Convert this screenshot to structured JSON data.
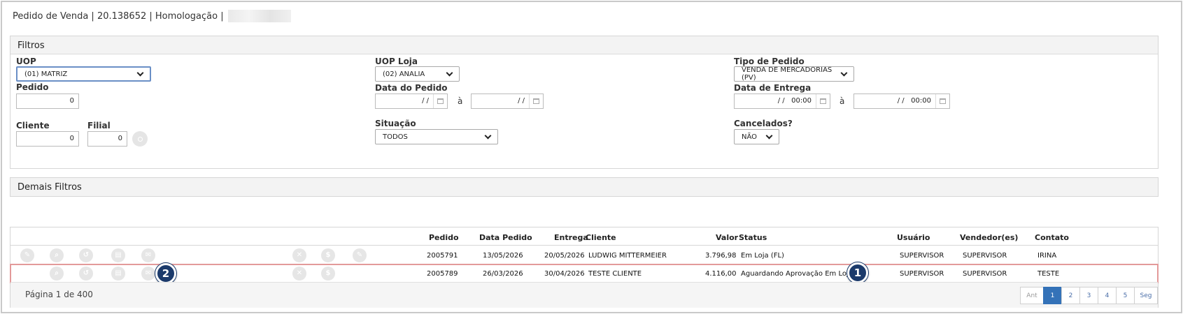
{
  "header": {
    "title": "Pedido de Venda | 20.138652 | Homologação |"
  },
  "filters": {
    "title": "Filtros",
    "uop": {
      "label": "UOP",
      "value": "(01) MATRIZ"
    },
    "uop_loja": {
      "label": "UOP Loja",
      "value": "(02) ANALIA"
    },
    "tipo_pedido": {
      "label": "Tipo de Pedido",
      "value": "VENDA DE MERCADORIAS (PV)"
    },
    "pedido": {
      "label": "Pedido",
      "value": "0"
    },
    "data_pedido": {
      "label": "Data do Pedido",
      "from": "/ /",
      "to": "/ /",
      "sep": "à"
    },
    "data_entrega": {
      "label": "Data de Entrega",
      "from": "/ /   00:00",
      "to": "/ /   00:00",
      "sep": "à"
    },
    "cliente": {
      "label": "Cliente",
      "value": "0"
    },
    "filial": {
      "label": "Filial",
      "value": "0"
    },
    "situacao": {
      "label": "Situação",
      "value": "TODOS"
    },
    "cancelados": {
      "label": "Cancelados?",
      "value": "NÃO"
    }
  },
  "more_filters": {
    "title": "Demais Filtros"
  },
  "grid": {
    "columns": {
      "pedido": "Pedido",
      "data_pedido": "Data Pedido",
      "entrega": "Entrega",
      "cliente": "Cliente",
      "valor": "Valor",
      "status": "Status",
      "usuario": "Usuário",
      "vendedor": "Vendedor(es)",
      "contato": "Contato"
    },
    "rows": [
      {
        "pedido": "2005791",
        "data_pedido": "13/05/2026",
        "entrega": "20/05/2026",
        "cliente": "LUDWIG MITTERMEIER",
        "valor": "3.796,98",
        "status": "Em Loja (FL)",
        "usuario": "SUPERVISOR",
        "vendedor": "SUPERVISOR",
        "contato": "IRINA"
      },
      {
        "pedido": "2005789",
        "data_pedido": "26/03/2026",
        "entrega": "30/04/2026",
        "cliente": "TESTE CLIENTE",
        "valor": "4.116,00",
        "status": "Aguardando Aprovação Em Loja (EE)",
        "usuario": "SUPERVISOR",
        "vendedor": "SUPERVISOR",
        "contato": "TESTE"
      }
    ],
    "badges": [
      "1",
      "2"
    ]
  },
  "pagination": {
    "info": "Página 1 de 400",
    "prev": "Ant",
    "next": "Seg",
    "pages": [
      "1",
      "2",
      "3",
      "4",
      "5"
    ],
    "current": "1"
  },
  "colors": {
    "highlight_row": "#e39a9a",
    "badge": "#1b3a6b",
    "active_page": "#3472b8"
  }
}
